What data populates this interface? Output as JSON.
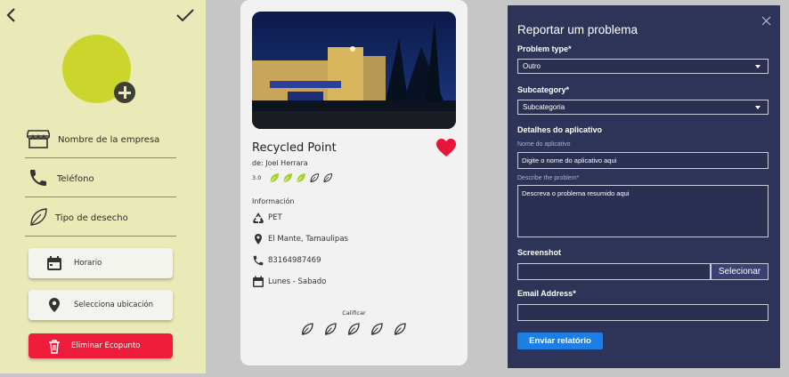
{
  "profile_form": {
    "fields": [
      {
        "label": "Nombre de la empresa",
        "icon": "storefront-icon"
      },
      {
        "label": "Teléfono",
        "icon": "phone-icon"
      },
      {
        "label": "Tipo de desecho",
        "icon": "leaf-icon"
      }
    ],
    "buttons": [
      {
        "label": "Horario",
        "icon": "calendar-icon"
      },
      {
        "label": "Selecciona ubicación",
        "icon": "location-pin-icon"
      },
      {
        "label": "Eliminar Ecopunto",
        "icon": "trash-icon"
      }
    ],
    "accent_color": "#cbd52c",
    "danger_color": "#ee1c3a"
  },
  "place_card": {
    "title": "Recycled Point",
    "author": "de: Joel Herrara",
    "rating_value": "3.0",
    "rating_filled": 3,
    "rating_max": 5,
    "section_title": "Información",
    "details": [
      {
        "icon": "recycle-icon",
        "text": "PET"
      },
      {
        "icon": "location-pin-icon",
        "text": "El Mante, Tamaulipas"
      },
      {
        "icon": "phone-icon",
        "text": "83164987469"
      },
      {
        "icon": "calendar-icon",
        "text": "Lunes - Sabado"
      }
    ],
    "rate_label": "Calificar",
    "rate_max": 5,
    "favorite_color": "#e8143a",
    "leaf_color": "#a6cf2e"
  },
  "report_dialog": {
    "title": "Reportar um problema",
    "problem_type_label": "Problem type*",
    "problem_type_value": "Outro",
    "subcategory_label": "Subcategory*",
    "subcategory_value": "Subcategoria",
    "app_details_label": "Detalhes do aplicativo",
    "app_name_label": "Nome do aplicativo",
    "app_name_value": "Digite o nome do aplicativo aqui",
    "describe_label": "Describe the problem*",
    "describe_value": "Descreva o problema resumido aqui",
    "screenshot_label": "Screenshot",
    "select_button": "Selecionar",
    "email_label": "Email Address*",
    "email_value": "",
    "submit_button": "Enviar relatório",
    "background_color": "#2e3458",
    "button_color": "#1f7de6"
  }
}
